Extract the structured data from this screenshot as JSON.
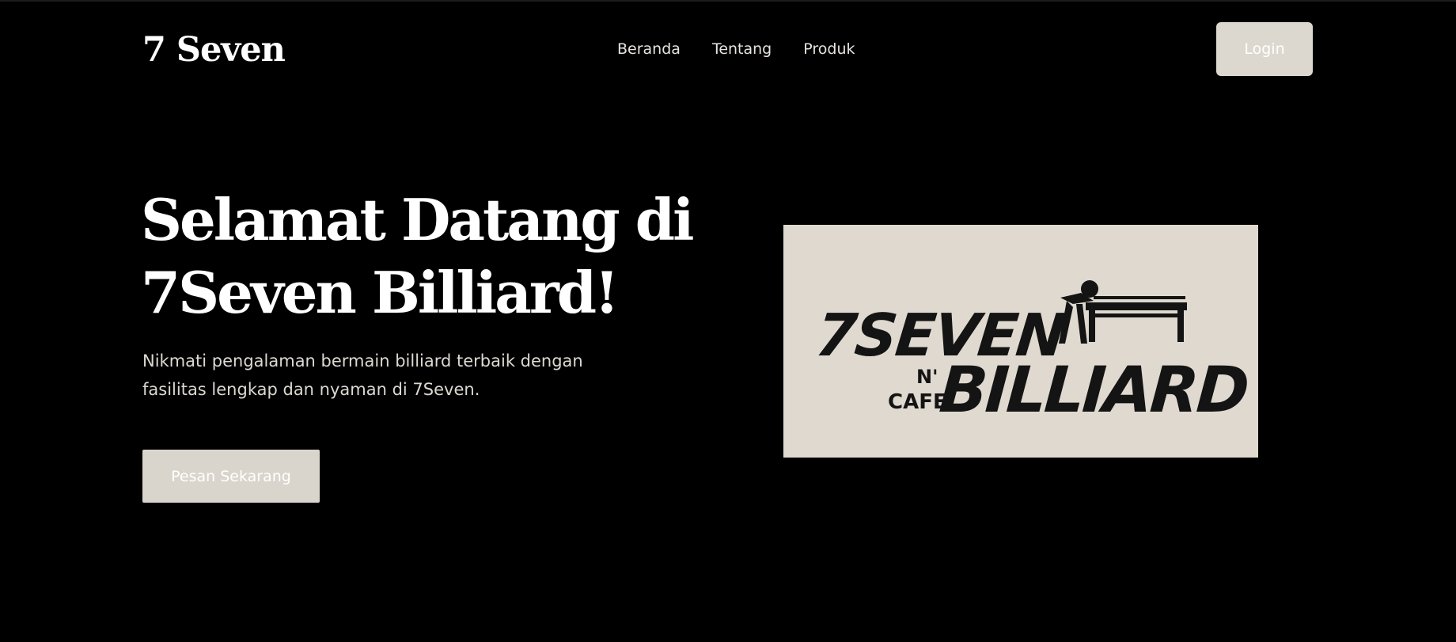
{
  "navbar": {
    "brand": "7 Seven",
    "links": [
      "Beranda",
      "Tentang",
      "Produk"
    ],
    "login_label": "Login"
  },
  "hero": {
    "title_line1": "Selamat Datang di",
    "title_line2": "7Seven Billiard!",
    "description": "Nikmati pengalaman bermain billiard terbaik dengan fasilitas lengkap dan nyaman di 7Seven.",
    "cta_label": "Pesan Sekarang"
  },
  "logo": {
    "line1": "7SEVEN",
    "n": "N'",
    "cafe": "CAFE",
    "billiard": "BILLIARD"
  },
  "colors": {
    "background": "#000000",
    "button": "#dcd8cf",
    "logo_bg": "#dfd9cf",
    "logo_ink": "#141414"
  }
}
